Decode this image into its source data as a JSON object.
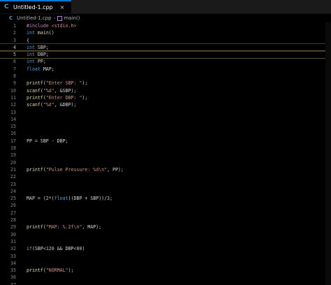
{
  "tab": {
    "filename": "Untitled-1.cpp",
    "icon": "c-icon",
    "close_glyph": "×"
  },
  "breadcrumb": {
    "file": "Untitled-1.cpp",
    "separator": "›",
    "symbol": "main()"
  },
  "colors": {
    "keyword": "#569cd6",
    "preprocessor": "#c586c0",
    "string": "#ce9178",
    "number": "#b5cea8",
    "function": "#dcdcaa",
    "identifier": "#9cdcfe",
    "line_number": "#858585",
    "tab_accent": "#0078d4"
  },
  "editor": {
    "lines": [
      {
        "n": "1",
        "tokens": [
          [
            "pp",
            "#include"
          ],
          [
            "",
            " "
          ],
          [
            "str",
            "<stdio.h>"
          ]
        ]
      },
      {
        "n": "2",
        "tokens": [
          [
            "kw",
            "int"
          ],
          [
            "",
            " "
          ],
          [
            "fn",
            "main"
          ],
          [
            "",
            "()"
          ]
        ]
      },
      {
        "n": "3",
        "tokens": [
          [
            "",
            "{"
          ]
        ]
      },
      {
        "n": "4",
        "tokens": [
          [
            "kw",
            "int"
          ],
          [
            "",
            " SBP;"
          ]
        ]
      },
      {
        "n": "5",
        "tokens": [
          [
            "kw",
            "int"
          ],
          [
            "",
            " DBP;"
          ]
        ]
      },
      {
        "n": "6",
        "tokens": [
          [
            "kw",
            "int"
          ],
          [
            "",
            " PP;"
          ]
        ]
      },
      {
        "n": "7",
        "tokens": [
          [
            "kw",
            "float"
          ],
          [
            "",
            " MAP;"
          ]
        ]
      },
      {
        "n": "8",
        "tokens": []
      },
      {
        "n": "9",
        "tokens": [
          [
            "fn",
            "printf"
          ],
          [
            "",
            "("
          ],
          [
            "str",
            "\"Enter SBP: \""
          ],
          [
            "",
            ");"
          ]
        ]
      },
      {
        "n": "10",
        "tokens": [
          [
            "fn",
            "scanf"
          ],
          [
            "",
            "("
          ],
          [
            "str",
            "\"%d\""
          ],
          [
            "",
            ", &SBP);"
          ]
        ]
      },
      {
        "n": "11",
        "tokens": [
          [
            "fn",
            "printf"
          ],
          [
            "",
            "("
          ],
          [
            "str",
            "\"Enter DBP: \""
          ],
          [
            "",
            ");"
          ]
        ]
      },
      {
        "n": "12",
        "tokens": [
          [
            "fn",
            "scanf"
          ],
          [
            "",
            "("
          ],
          [
            "str",
            "\"%d\""
          ],
          [
            "",
            ", &DBP);"
          ]
        ]
      },
      {
        "n": "13",
        "tokens": []
      },
      {
        "n": "14",
        "tokens": []
      },
      {
        "n": "15",
        "tokens": []
      },
      {
        "n": "16",
        "tokens": []
      },
      {
        "n": "17",
        "tokens": [
          [
            "",
            "PP = SBP - DBP;"
          ]
        ]
      },
      {
        "n": "18",
        "tokens": []
      },
      {
        "n": "19",
        "tokens": []
      },
      {
        "n": "20",
        "tokens": []
      },
      {
        "n": "21",
        "tokens": [
          [
            "fn",
            "printf"
          ],
          [
            "",
            "("
          ],
          [
            "str",
            "\"Pulse Pressure: %d\\n\""
          ],
          [
            "",
            ", PP);"
          ]
        ]
      },
      {
        "n": "22",
        "tokens": []
      },
      {
        "n": "23",
        "tokens": []
      },
      {
        "n": "24",
        "tokens": []
      },
      {
        "n": "25",
        "tokens": [
          [
            "",
            "MAP = ("
          ],
          [
            "num",
            "2"
          ],
          [
            "",
            "*("
          ],
          [
            "kw",
            "float"
          ],
          [
            "",
            ")(DBP + SBP))/"
          ],
          [
            "num",
            "3"
          ],
          [
            "",
            ";"
          ]
        ]
      },
      {
        "n": "26",
        "tokens": []
      },
      {
        "n": "27",
        "tokens": []
      },
      {
        "n": "28",
        "tokens": []
      },
      {
        "n": "29",
        "tokens": [
          [
            "fn",
            "printf"
          ],
          [
            "",
            "("
          ],
          [
            "str",
            "\"MAP: %.2f\\n\""
          ],
          [
            "",
            ", MAP);"
          ]
        ]
      },
      {
        "n": "30",
        "tokens": []
      },
      {
        "n": "31",
        "tokens": []
      },
      {
        "n": "32",
        "tokens": [
          [
            "pp",
            "if"
          ],
          [
            "",
            "(SBP<"
          ],
          [
            "num",
            "120"
          ],
          [
            "",
            " && DBP<"
          ],
          [
            "num",
            "80"
          ],
          [
            "",
            ")"
          ]
        ]
      },
      {
        "n": "33",
        "tokens": []
      },
      {
        "n": "34",
        "tokens": []
      },
      {
        "n": "35",
        "tokens": [
          [
            "fn",
            "printf"
          ],
          [
            "",
            "("
          ],
          [
            "str",
            "\"NORMAL\""
          ],
          [
            "",
            ");"
          ]
        ]
      },
      {
        "n": "36",
        "tokens": []
      },
      {
        "n": "37",
        "tokens": []
      }
    ]
  }
}
